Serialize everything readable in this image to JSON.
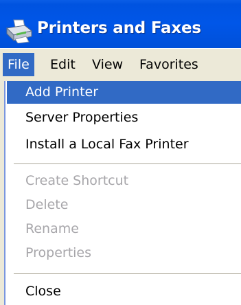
{
  "window": {
    "title": "Printers and Faxes",
    "icon": "printer-fax-icon"
  },
  "menubar": {
    "items": [
      {
        "label": "File",
        "active": true
      },
      {
        "label": "Edit",
        "active": false
      },
      {
        "label": "View",
        "active": false
      },
      {
        "label": "Favorites",
        "active": false
      }
    ]
  },
  "file_menu": {
    "items": [
      {
        "label": "Add Printer",
        "state": "highlighted"
      },
      {
        "label": "Server Properties",
        "state": "enabled"
      },
      {
        "label": "Install a Local Fax Printer",
        "state": "enabled"
      },
      {
        "label": "Create Shortcut",
        "state": "disabled"
      },
      {
        "label": "Delete",
        "state": "disabled"
      },
      {
        "label": "Rename",
        "state": "disabled"
      },
      {
        "label": "Properties",
        "state": "disabled"
      },
      {
        "label": "Close",
        "state": "enabled"
      }
    ]
  },
  "colors": {
    "titlebar": "#0054e3",
    "highlight": "#316ac5",
    "menubar": "#ece9d8",
    "disabled_text": "#a7a6aa"
  }
}
